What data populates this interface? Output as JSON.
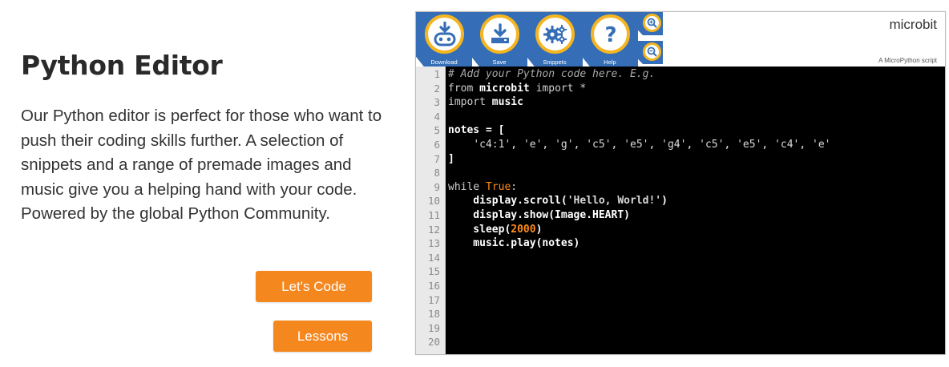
{
  "intro": {
    "heading": "Python Editor",
    "paragraph": "Our Python editor is perfect for those who want to push their coding skills further. A selection of snippets and a range of premade images and music give you a helping hand with your code. Powered by the global Python Community."
  },
  "buttons": {
    "lets_code": "Let's Code",
    "lessons": "Lessons"
  },
  "editor": {
    "brand": "microbit",
    "subtitle": "A MicroPython script",
    "toolbar": [
      {
        "label": "Download",
        "icon": "download-robot-icon"
      },
      {
        "label": "Save",
        "icon": "save-download-icon"
      },
      {
        "label": "Snippets",
        "icon": "gears-icon"
      },
      {
        "label": "Help",
        "icon": "question-icon"
      }
    ],
    "zoom": [
      {
        "icon": "zoom-in-icon"
      },
      {
        "icon": "zoom-out-icon"
      }
    ],
    "lines": [
      "# Add your Python code here. E.g.",
      "from microbit import *",
      "import music",
      "",
      "notes = [",
      "    'c4:1', 'e', 'g', 'c5', 'e5', 'g4', 'c5', 'e5', 'c4', 'e'",
      "]",
      "",
      "while True:",
      "    display.scroll('Hello, World!')",
      "    display.show(Image.HEART)",
      "    sleep(2000)",
      "    music.play(notes)",
      "",
      "",
      "",
      "",
      "",
      "",
      ""
    ],
    "line_numbers": [
      "1",
      "2",
      "3",
      "4",
      "5",
      "6",
      "7",
      "8",
      "9",
      "10",
      "11",
      "12",
      "13",
      "14",
      "15",
      "16",
      "17",
      "18",
      "19",
      "20"
    ]
  },
  "colors": {
    "accent_orange": "#f5871f",
    "toolbar_blue": "#356eb6",
    "ring_yellow": "#f5b520",
    "code_bg": "#000000"
  }
}
